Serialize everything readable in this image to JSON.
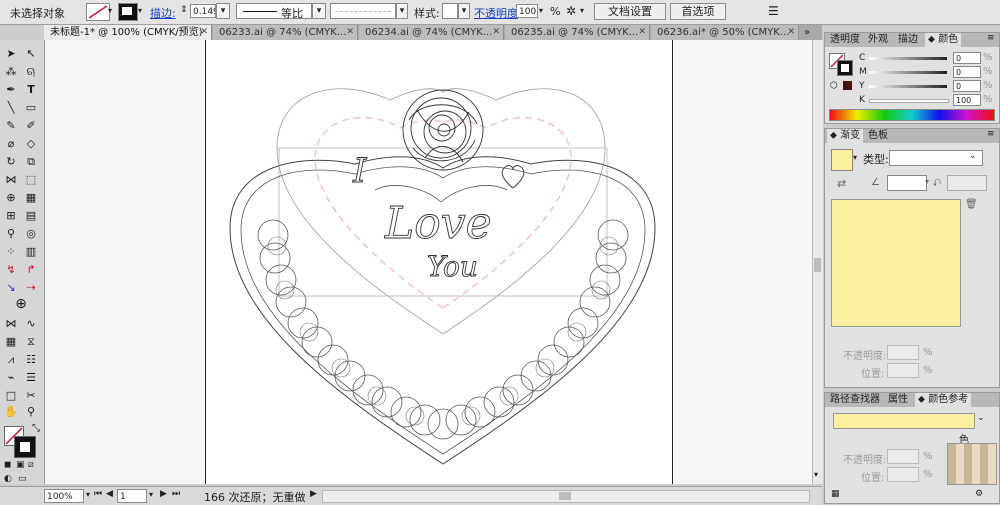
{
  "control_bar": {
    "selection_status": "未选择对象",
    "stroke_label": "描边:",
    "stroke_weight": "0.149",
    "profile_label": "等比",
    "style_label": "样式:",
    "opacity_label": "不透明度",
    "opacity_value": "100",
    "percent_sign": "%",
    "doc_setup_button": "文档设置",
    "preferences_button": "首选项"
  },
  "document_tabs": [
    {
      "label": "未标题-1* @ 100% (CMYK/预览)",
      "active": true
    },
    {
      "label": "06233.ai @ 74% (CMYK...",
      "active": false
    },
    {
      "label": "06234.ai @ 74% (CMYK...",
      "active": false
    },
    {
      "label": "06235.ai @ 74% (CMYK...",
      "active": false
    },
    {
      "label": "06236.ai* @ 50% (CMYK...",
      "active": false
    }
  ],
  "artwork": {
    "line1": "I",
    "line2": "Love",
    "line3": "You"
  },
  "color_panel": {
    "tabs": [
      "透明度",
      "外观",
      "描边",
      "颜色"
    ],
    "active_tab": "颜色",
    "channels": [
      {
        "name": "C",
        "value": "0"
      },
      {
        "name": "M",
        "value": "0"
      },
      {
        "name": "Y",
        "value": "0"
      },
      {
        "name": "K",
        "value": "100"
      }
    ]
  },
  "gradient_panel": {
    "tabs": [
      "渐变",
      "色板"
    ],
    "active_tab": "渐变",
    "type_label": "类型:",
    "opacity_label": "不透明度:",
    "location_label": "位置:",
    "percent_sign": "%",
    "swatch_color": "#fcf0a0"
  },
  "bottom_panel": {
    "tabs": [
      "路径查找器",
      "属性",
      "颜色参考"
    ],
    "active_tab": "颜色参考",
    "opacity_label": "不透明度:",
    "location_label": "位置:",
    "percent_sign": "%",
    "partial_label": "色"
  },
  "status_bar": {
    "zoom": "100%",
    "artboard_number": "1",
    "status_text": "166 次还原；无重做"
  },
  "colors": {
    "accent_red": "#c8102e",
    "artboard": "#ffffff",
    "canvas_bg": "#f6f6f6",
    "panel_bg": "#e1e1e1"
  }
}
